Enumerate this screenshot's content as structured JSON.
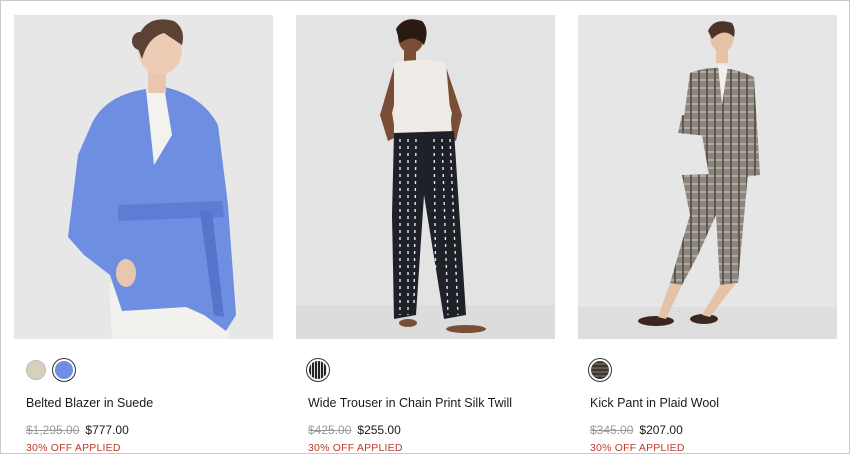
{
  "products": [
    {
      "name": "Belted Blazer in Suede",
      "original_price": "$1,295.00",
      "sale_price": "$777.00",
      "promo": "30% OFF APPLIED",
      "swatches": [
        {
          "color": "#d6d0bd",
          "icon": "swatch-cream",
          "selected": false
        },
        {
          "color": "#6f8ee3",
          "icon": "swatch-blue",
          "selected": true
        }
      ]
    },
    {
      "name": "Wide Trouser in Chain Print Silk Twill",
      "original_price": "$425.00",
      "sale_price": "$255.00",
      "promo": "30% OFF APPLIED",
      "swatches": [
        {
          "color": "#2a2a2a",
          "icon": "swatch-black-stripe",
          "selected": true
        }
      ]
    },
    {
      "name": "Kick Pant in Plaid Wool",
      "original_price": "$345.00",
      "sale_price": "$207.00",
      "promo": "30% OFF APPLIED",
      "swatches": [
        {
          "color": "#8a8580",
          "icon": "swatch-plaid",
          "selected": true
        }
      ]
    }
  ],
  "colors": {
    "promo_red": "#c0392b",
    "strike_gray": "#9a9a9a",
    "photo_bg": "#e6e6e7"
  }
}
